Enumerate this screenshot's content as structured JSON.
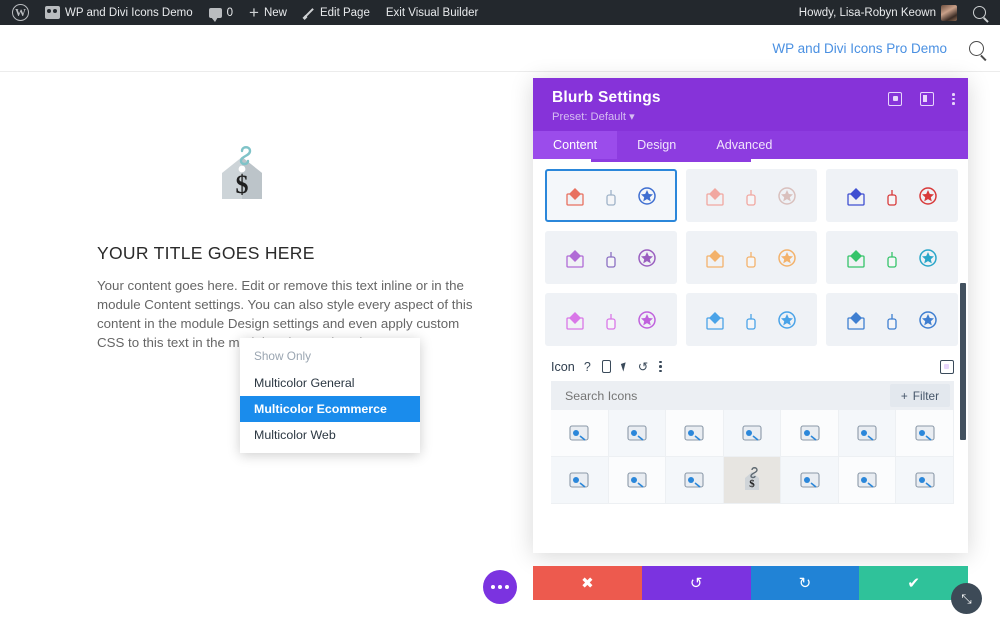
{
  "adminbar": {
    "wp_logo_icon": "wordpress-logo-icon",
    "site_icon": "site-dashboard-icon",
    "site_name": "WP and Divi Icons Demo",
    "comments_icon": "comment-bubble-icon",
    "comments_count": "0",
    "new_icon": "plus-icon",
    "new_label": "New",
    "edit_icon": "pencil-icon",
    "edit_label": "Edit Page",
    "exit_label": "Exit Visual Builder",
    "howdy": "Howdy, Lisa-Robyn Keown",
    "avatar_icon": "user-avatar-icon",
    "search_icon": "search-icon"
  },
  "siteheader": {
    "nav_link": "WP and Divi Icons Pro Demo",
    "search_icon": "search-icon"
  },
  "preview": {
    "blurb_icon": "price-tag-dollar-icon",
    "title": "YOUR TITLE GOES HERE",
    "body": "Your content goes here. Edit or remove this text inline or in the module Content settings. You can also style every aspect of this content in the module Design settings and even apply custom CSS to this text in the module Advanced settings."
  },
  "modal": {
    "title": "Blurb Settings",
    "preset": "Preset: Default",
    "preset_caret": "▾",
    "head_icons": [
      "focus-target-icon",
      "column-layout-icon",
      "more-vertical-icon"
    ],
    "tabs": [
      {
        "label": "Content",
        "active": true
      },
      {
        "label": "Design",
        "active": false
      },
      {
        "label": "Advanced",
        "active": false
      }
    ],
    "families": [
      {
        "name": "multicolor-general-selected",
        "selected": true,
        "icons": [
          "envelope-heart-icon",
          "perfume-bottle-icon",
          "star-badge-icon"
        ],
        "colors": [
          "#e8705f",
          "#9fb3c8",
          "#3f6fd1"
        ]
      },
      {
        "name": "multicolor-wedding",
        "selected": false,
        "icons": [
          "ring-icon",
          "medal-icon",
          "gift-icon"
        ],
        "colors": [
          "#f1a7a0",
          "#f1a7a0",
          "#d9c0bd"
        ]
      },
      {
        "name": "multicolor-media",
        "selected": false,
        "icons": [
          "photo-icon",
          "aperture-icon",
          "film-strip-icon"
        ],
        "colors": [
          "#3f4fd1",
          "#d83a3a",
          "#d83a3a"
        ]
      },
      {
        "name": "multicolor-time",
        "selected": false,
        "icons": [
          "clock-icon",
          "rabbit-icon",
          "heart-leaf-icon"
        ],
        "colors": [
          "#b06bd6",
          "#8b6fc2",
          "#9a5fc0"
        ]
      },
      {
        "name": "multicolor-baby",
        "selected": false,
        "icons": [
          "baby-carriage-icon",
          "rattle-icon",
          "baby-bottle-icon"
        ],
        "colors": [
          "#f3b26b",
          "#f3b26b",
          "#f3b26b"
        ]
      },
      {
        "name": "multicolor-medical",
        "selected": false,
        "icons": [
          "medical-cross-icon",
          "tooth-icon",
          "magnifier-icon"
        ],
        "colors": [
          "#35c46a",
          "#35c46a",
          "#2aa6c9"
        ]
      },
      {
        "name": "multicolor-creative",
        "selected": false,
        "icons": [
          "cube-icon",
          "hourglass-money-icon",
          "music-book-icon"
        ],
        "colors": [
          "#d977e8",
          "#d977e8",
          "#c062dd"
        ]
      },
      {
        "name": "multicolor-business",
        "selected": false,
        "icons": [
          "wallet-icon",
          "checklist-icon",
          "globe-document-icon"
        ],
        "colors": [
          "#4aa3e8",
          "#4aa3e8",
          "#4aa3e8"
        ]
      },
      {
        "name": "multicolor-office",
        "selected": false,
        "icons": [
          "calendar-icon",
          "piggy-bank-icon",
          "bank-icon"
        ],
        "colors": [
          "#3f7fd1",
          "#3f7fd1",
          "#3f7fd1"
        ]
      }
    ],
    "icon_field": {
      "label": "Icon",
      "help_icon": "help-question-icon",
      "responsive_icon": "phone-responsive-icon",
      "hover_icon": "cursor-hover-icon",
      "reset_icon": "reset-undo-icon",
      "more_icon": "more-vertical-icon",
      "focus_icon": "focus-target-icon"
    },
    "search": {
      "placeholder": "Search Icons",
      "value": "",
      "filter_label": "Filter",
      "filter_icon": "plus-icon"
    },
    "icon_results": [
      {
        "name": "delivery-drop-icon",
        "selected": false
      },
      {
        "name": "calculator-icon",
        "selected": false
      },
      {
        "name": "question-coin-icon",
        "selected": false
      },
      {
        "name": "alert-coin-icon",
        "selected": false
      },
      {
        "name": "euro-coins-icon",
        "selected": false
      },
      {
        "name": "coin-search-icon",
        "selected": false
      },
      {
        "name": "globe-click-icon",
        "selected": false
      },
      {
        "name": "user-piggybank-icon",
        "selected": false
      },
      {
        "name": "invoice-edit-icon",
        "selected": false
      },
      {
        "name": "package-open-icon",
        "selected": false
      },
      {
        "name": "price-tag-dollar-icon",
        "selected": true
      },
      {
        "name": "shield-check-icon",
        "selected": false
      },
      {
        "name": "cart-icon",
        "selected": false
      },
      {
        "name": "tag-icon",
        "selected": false
      }
    ],
    "dropdown": {
      "header": "Show Only",
      "items": [
        {
          "label": "Multicolor General",
          "active": false
        },
        {
          "label": "Multicolor Ecommerce",
          "active": true
        },
        {
          "label": "Multicolor Web",
          "active": false
        }
      ]
    }
  },
  "bottombar": {
    "buttons": [
      {
        "name": "discard-button",
        "icon": "close-x-icon",
        "glyph": "✖",
        "color": "#ed5a4e"
      },
      {
        "name": "undo-button",
        "icon": "undo-icon",
        "glyph": "↺",
        "color": "#7b33e0"
      },
      {
        "name": "redo-button",
        "icon": "redo-icon",
        "glyph": "↻",
        "color": "#2183d6"
      },
      {
        "name": "save-button",
        "icon": "checkmark-icon",
        "glyph": "✔",
        "color": "#2fc29a"
      }
    ],
    "fab_icon": "more-options-icon",
    "resize_icon": "resize-handle-icon",
    "resize_glyph": "⤡"
  },
  "colors": {
    "admin_bar": "#23282d",
    "modal_header": "#8633d9",
    "tab_active": "#9b4ceb",
    "accent_blue": "#1a8cec",
    "link_blue": "#4a90e2"
  }
}
